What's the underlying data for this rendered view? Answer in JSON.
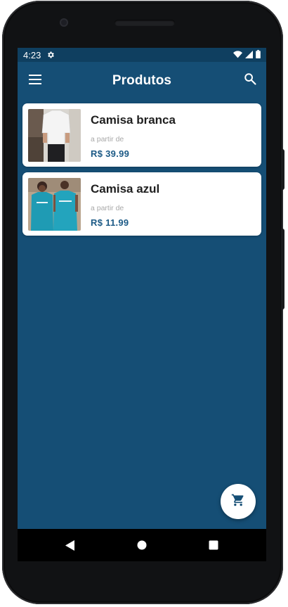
{
  "status_bar": {
    "time": "4:23",
    "icons": [
      "settings-gear-icon",
      "wifi-icon",
      "cell-signal-icon",
      "battery-icon"
    ]
  },
  "app_bar": {
    "title": "Produtos",
    "left_icon": "menu-icon",
    "right_icon": "search-icon"
  },
  "products": [
    {
      "name": "Camisa branca",
      "from_label": "a partir de",
      "price": "R$ 39.99",
      "image": "white-shirt-photo"
    },
    {
      "name": "Camisa azul",
      "from_label": "a partir de",
      "price": "R$ 11.99",
      "image": "blue-shirt-photo"
    }
  ],
  "fab": {
    "icon": "shopping-cart-icon"
  },
  "nav_bar": {
    "icons": [
      "back-icon",
      "home-icon",
      "recents-icon"
    ]
  },
  "colors": {
    "primary": "#154e75",
    "status_bar": "#0f3f60",
    "price": "#1c5a86",
    "card": "#ffffff"
  }
}
